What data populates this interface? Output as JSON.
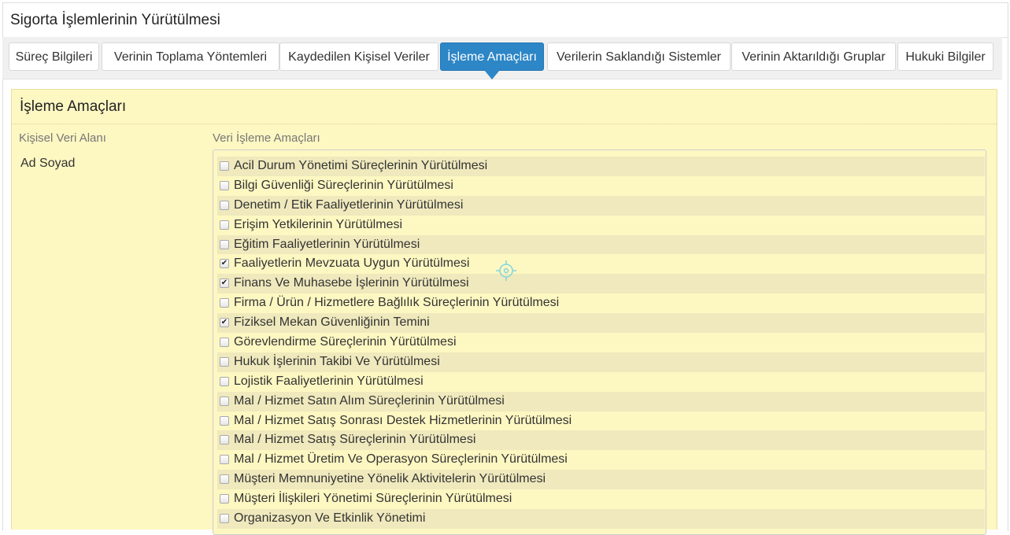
{
  "page": {
    "title": "Sigorta İşlemlerinin Yürütülmesi"
  },
  "tabs": [
    {
      "label": "Süreç Bilgileri",
      "active": false
    },
    {
      "label": "Verinin Toplama Yöntemleri",
      "active": false
    },
    {
      "label": "Kaydedilen Kişisel Veriler",
      "active": false
    },
    {
      "label": "İşleme Amaçları",
      "active": true
    },
    {
      "label": "Verilerin Saklandığı Sistemler",
      "active": false
    },
    {
      "label": "Verinin Aktarıldığı Gruplar",
      "active": false
    },
    {
      "label": "Hukuki Bilgiler",
      "active": false
    }
  ],
  "panel": {
    "heading": "İşleme Amaçları",
    "left_column_label": "Kişisel Veri Alanı",
    "right_column_label": "Veri İşleme Amaçları",
    "field_value": "Ad Soyad"
  },
  "purposes": [
    {
      "label": "Acil Durum Yönetimi Süreçlerinin Yürütülmesi",
      "checked": false
    },
    {
      "label": "Bilgi Güvenliği Süreçlerinin Yürütülmesi",
      "checked": false
    },
    {
      "label": "Denetim / Etik Faaliyetlerinin Yürütülmesi",
      "checked": false
    },
    {
      "label": "Erişim Yetkilerinin Yürütülmesi",
      "checked": false
    },
    {
      "label": "Eğitim Faaliyetlerinin Yürütülmesi",
      "checked": false
    },
    {
      "label": "Faaliyetlerin Mevzuata Uygun Yürütülmesi",
      "checked": true
    },
    {
      "label": "Finans Ve Muhasebe İşlerinin Yürütülmesi",
      "checked": true
    },
    {
      "label": "Firma / Ürün / Hizmetlere Bağlılık Süreçlerinin Yürütülmesi",
      "checked": false
    },
    {
      "label": "Fiziksel Mekan Güvenliğinin Temini",
      "checked": true
    },
    {
      "label": "Görevlendirme Süreçlerinin Yürütülmesi",
      "checked": false
    },
    {
      "label": "Hukuk İşlerinin Takibi Ve Yürütülmesi",
      "checked": false
    },
    {
      "label": "Lojistik Faaliyetlerinin Yürütülmesi",
      "checked": false
    },
    {
      "label": "Mal / Hizmet Satın Alım Süreçlerinin Yürütülmesi",
      "checked": false
    },
    {
      "label": "Mal / Hizmet Satış Sonrası Destek Hizmetlerinin Yürütülmesi",
      "checked": false
    },
    {
      "label": "Mal / Hizmet Satış Süreçlerinin Yürütülmesi",
      "checked": false
    },
    {
      "label": "Mal / Hizmet Üretim Ve Operasyon Süreçlerinin Yürütülmesi",
      "checked": false
    },
    {
      "label": "Müşteri Memnuniyetine Yönelik Aktivitelerin Yürütülmesi",
      "checked": false
    },
    {
      "label": "Müşteri İlişkileri Yönetimi Süreçlerinin Yürütülmesi",
      "checked": false
    },
    {
      "label": "Organizasyon Ve Etkinlik Yönetimi",
      "checked": false
    }
  ],
  "colors": {
    "active_tab": "#2d86c6",
    "panel_background": "#fdf7c2",
    "row_stripe": "#efe9bd"
  },
  "icons": {
    "cursor": "crosshair-cursor-icon",
    "checkbox_checked": "checkmark-icon"
  }
}
